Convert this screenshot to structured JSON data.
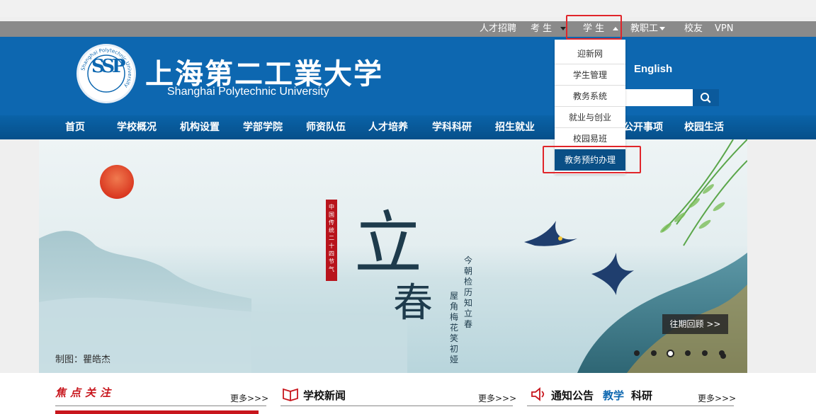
{
  "topbar": {
    "items": [
      {
        "label": "人才招聘"
      },
      {
        "label": "考 生"
      },
      {
        "label": "学 生"
      },
      {
        "label": "教职工"
      },
      {
        "label": "校友"
      },
      {
        "label": "VPN"
      }
    ]
  },
  "header": {
    "logo_text": "SSP",
    "logo_ring_text": "Shanghai Polytechnic University",
    "logo_ring_text_cn": "上海第二工业大学",
    "school_name_cn": "上海第二工業大学",
    "school_name_en": "Shanghai Polytechnic University",
    "english_link": "English"
  },
  "student_dropdown": {
    "items": [
      {
        "label": "迎新网"
      },
      {
        "label": "学生管理"
      },
      {
        "label": "教务系统"
      },
      {
        "label": "就业与创业"
      },
      {
        "label": "校园易班"
      },
      {
        "label": "教务预约办理"
      }
    ]
  },
  "nav": {
    "items": [
      {
        "label": "首页"
      },
      {
        "label": "学校概况"
      },
      {
        "label": "机构设置"
      },
      {
        "label": "学部学院"
      },
      {
        "label": "师资队伍"
      },
      {
        "label": "人才培养"
      },
      {
        "label": "学科科研"
      },
      {
        "label": "招生就业"
      },
      {
        "label": "公开事项"
      },
      {
        "label": "校园生活"
      }
    ]
  },
  "banner": {
    "big_char_1": "立",
    "big_char_2": "春",
    "seal_text": "中国传统二十四节气",
    "poem_line_1": "今朝检历知立春",
    "poem_line_2": "屋角梅花笑初娅",
    "caption": "制图：瞿皓杰",
    "history_button": "往期回顾 >>",
    "slide_count": 7,
    "active_slide": 2
  },
  "sections": {
    "focus": {
      "title": "焦点关注",
      "more": "更多>>>"
    },
    "news": {
      "title": "学校新闻",
      "more": "更多>>>"
    },
    "notice": {
      "title": "通知公告",
      "tab_1": "教学",
      "tab_2": "科研",
      "more": "更多>>>"
    }
  },
  "colors": {
    "header_blue": "#0d67b0",
    "topbar_gray": "#8a8a8a",
    "highlight_red": "#e0252a",
    "focus_red": "#c8161d",
    "dropdown_highlight": "#0a4f86"
  }
}
